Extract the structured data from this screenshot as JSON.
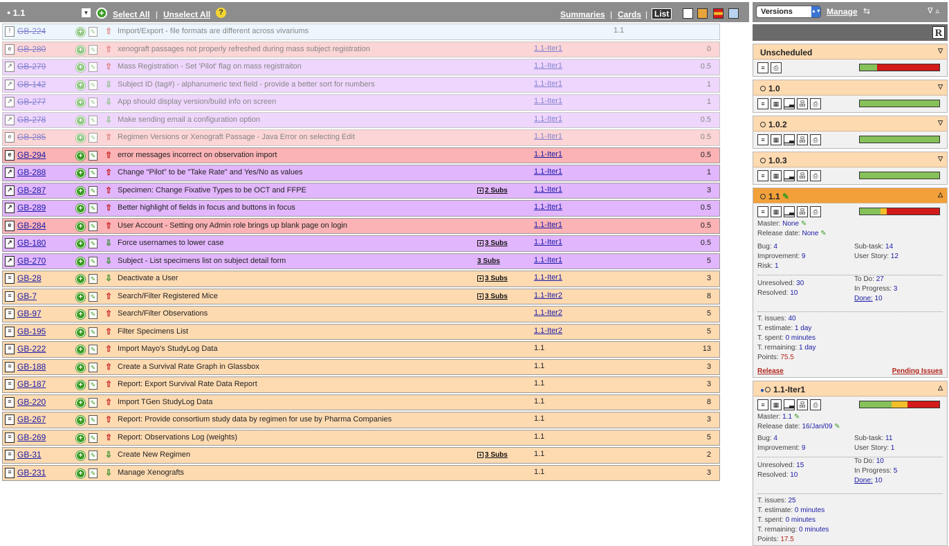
{
  "header": {
    "title": "1.1",
    "select_all": "Select All",
    "separator": "|",
    "unselect_all": "Unselect All",
    "views": [
      "Summaries",
      "Cards",
      "List"
    ],
    "active_view": "List"
  },
  "issues": [
    {
      "key": "GB-224",
      "type": "info",
      "type_glyph": "!",
      "priority": "up",
      "summary": "Import/Export - file formats are different across vivariums",
      "subs": "",
      "subs_plus": false,
      "version": "1.1",
      "version_link": false,
      "points": "",
      "done": true,
      "ver_offset": true
    },
    {
      "key": "GB-280",
      "type": "bug",
      "type_glyph": "e",
      "priority": "up",
      "summary": "xenograft passages not properly refreshed during mass subject registration",
      "subs": "",
      "subs_plus": false,
      "version": "1.1-Iter1",
      "version_link": true,
      "points": "0",
      "done": true
    },
    {
      "key": "GB-279",
      "type": "impr",
      "type_glyph": "↗",
      "priority": "up",
      "summary": "Mass Registration - Set 'Pilot' flag on mass registraiton",
      "subs": "",
      "subs_plus": false,
      "version": "1.1-Iter1",
      "version_link": true,
      "points": "0.5",
      "done": true
    },
    {
      "key": "GB-142",
      "type": "impr",
      "type_glyph": "↗",
      "priority": "down",
      "summary": "Subject ID (tag#) - alphanumeric text field - provide a better sort for numbers",
      "subs": "",
      "subs_plus": false,
      "version": "1.1-Iter1",
      "version_link": true,
      "points": "1",
      "done": true
    },
    {
      "key": "GB-277",
      "type": "impr",
      "type_glyph": "↗",
      "priority": "down",
      "summary": "App should display version/build info on screen",
      "subs": "",
      "subs_plus": false,
      "version": "1.1-Iter1",
      "version_link": true,
      "points": "1",
      "done": true
    },
    {
      "key": "GB-278",
      "type": "impr",
      "type_glyph": "↗",
      "priority": "down",
      "summary": "Make sending email a configuration option",
      "subs": "",
      "subs_plus": false,
      "version": "1.1-Iter1",
      "version_link": true,
      "points": "0.5",
      "done": true
    },
    {
      "key": "GB-285",
      "type": "bug",
      "type_glyph": "e",
      "priority": "up",
      "summary": "Regimen Versions or Xenograft Passage - Java Error on selecting Edit",
      "subs": "",
      "subs_plus": false,
      "version": "1.1-Iter1",
      "version_link": true,
      "points": "0.5",
      "done": true
    },
    {
      "key": "GB-294",
      "type": "bug",
      "type_glyph": "e",
      "priority": "up",
      "summary": "error messages incorrect on observation import",
      "subs": "",
      "subs_plus": false,
      "version": "1.1-Iter1",
      "version_link": true,
      "points": "0.5",
      "done": false
    },
    {
      "key": "GB-288",
      "type": "impr",
      "type_glyph": "↗",
      "priority": "up",
      "summary": "Change \"Pilot\" to be \"Take Rate\" and Yes/No as values",
      "subs": "",
      "subs_plus": false,
      "version": "1.1-Iter1",
      "version_link": true,
      "points": "1",
      "done": false
    },
    {
      "key": "GB-287",
      "type": "impr",
      "type_glyph": "↗",
      "priority": "up",
      "summary": "Specimen: Change Fixative Types to be OCT and FFPE",
      "subs": "2 Subs",
      "subs_plus": true,
      "version": "1.1-Iter1",
      "version_link": true,
      "points": "3",
      "done": false
    },
    {
      "key": "GB-289",
      "type": "impr",
      "type_glyph": "↗",
      "priority": "up",
      "summary": "Better highlight of fields in focus and buttons in focus",
      "subs": "",
      "subs_plus": false,
      "version": "1.1-Iter1",
      "version_link": true,
      "points": "0.5",
      "done": false
    },
    {
      "key": "GB-284",
      "type": "bug",
      "type_glyph": "e",
      "priority": "up",
      "summary": "User Account - Setting ony Admin role brings up blank page on login",
      "subs": "",
      "subs_plus": false,
      "version": "1.1-Iter1",
      "version_link": true,
      "points": "0.5",
      "done": false
    },
    {
      "key": "GB-180",
      "type": "impr",
      "type_glyph": "↗",
      "priority": "down",
      "summary": "Force usernames to lower case",
      "subs": "3 Subs",
      "subs_plus": true,
      "version": "1.1-Iter1",
      "version_link": true,
      "points": "0.5",
      "done": false
    },
    {
      "key": "GB-270",
      "type": "impr",
      "type_glyph": "↗",
      "priority": "down",
      "summary": "Subject - List specimens list on subject detail form",
      "subs": "3 Subs",
      "subs_plus": false,
      "version": "1.1-Iter1",
      "version_link": true,
      "points": "5",
      "done": false
    },
    {
      "key": "GB-28",
      "type": "story",
      "type_glyph": "≡",
      "priority": "down",
      "summary": "Deactivate a User",
      "subs": "3 Subs",
      "subs_plus": true,
      "version": "1.1-Iter1",
      "version_link": true,
      "points": "3",
      "done": false
    },
    {
      "key": "GB-7",
      "type": "story",
      "type_glyph": "≡",
      "priority": "up",
      "summary": "Search/Filter Registered Mice",
      "subs": "3 Subs",
      "subs_plus": true,
      "version": "1.1-Iter2",
      "version_link": true,
      "points": "8",
      "done": false
    },
    {
      "key": "GB-97",
      "type": "story",
      "type_glyph": "≡",
      "priority": "up",
      "summary": "Search/Filter Observations",
      "subs": "",
      "subs_plus": false,
      "version": "1.1-Iter2",
      "version_link": true,
      "points": "5",
      "done": false
    },
    {
      "key": "GB-195",
      "type": "story",
      "type_glyph": "≡",
      "priority": "up",
      "summary": "Filter Specimens List",
      "subs": "",
      "subs_plus": false,
      "version": "1.1-Iter2",
      "version_link": true,
      "points": "5",
      "done": false
    },
    {
      "key": "GB-222",
      "type": "story",
      "type_glyph": "≡",
      "priority": "up",
      "summary": "Import Mayo's StudyLog Data",
      "subs": "",
      "subs_plus": false,
      "version": "1.1",
      "version_link": false,
      "points": "13",
      "done": false
    },
    {
      "key": "GB-188",
      "type": "story",
      "type_glyph": "≡",
      "priority": "up",
      "summary": "Create a Survival Rate Graph in Glassbox",
      "subs": "",
      "subs_plus": false,
      "version": "1.1",
      "version_link": false,
      "points": "3",
      "done": false
    },
    {
      "key": "GB-187",
      "type": "story",
      "type_glyph": "≡",
      "priority": "up",
      "summary": "Report: Export Survival Rate Data Report",
      "subs": "",
      "subs_plus": false,
      "version": "1.1",
      "version_link": false,
      "points": "3",
      "done": false
    },
    {
      "key": "GB-220",
      "type": "story",
      "type_glyph": "≡",
      "priority": "up",
      "summary": "Import TGen StudyLog Data",
      "subs": "",
      "subs_plus": false,
      "version": "1.1",
      "version_link": false,
      "points": "8",
      "done": false
    },
    {
      "key": "GB-267",
      "type": "story",
      "type_glyph": "≡",
      "priority": "up",
      "summary": "Report: Provide consortium study data by regimen for use by Pharma Companies",
      "subs": "",
      "subs_plus": false,
      "version": "1.1",
      "version_link": false,
      "points": "3",
      "done": false
    },
    {
      "key": "GB-269",
      "type": "story",
      "type_glyph": "≡",
      "priority": "up",
      "summary": "Report: Observations Log (weights)",
      "subs": "",
      "subs_plus": false,
      "version": "1.1",
      "version_link": false,
      "points": "5",
      "done": false
    },
    {
      "key": "GB-31",
      "type": "story",
      "type_glyph": "≡",
      "priority": "down",
      "summary": "Create New Regimen",
      "subs": "3 Subs",
      "subs_plus": true,
      "version": "1.1",
      "version_link": false,
      "points": "2",
      "done": false
    },
    {
      "key": "GB-231",
      "type": "story",
      "type_glyph": "≡",
      "priority": "down",
      "summary": "Manage Xenografts",
      "subs": "",
      "subs_plus": false,
      "version": "1.1",
      "version_link": false,
      "points": "3",
      "done": false
    }
  ],
  "panel": {
    "versions_select": "Versions",
    "manage": "Manage",
    "r_button": "R",
    "unscheduled": {
      "name": "Unscheduled",
      "progress": {
        "green": 0.22,
        "yellow": 0,
        "red": 0.78
      }
    },
    "collapsed": [
      {
        "name": "1.0",
        "progress": {
          "green": 1,
          "yellow": 0,
          "red": 0
        }
      },
      {
        "name": "1.0.2",
        "progress": {
          "green": 1,
          "yellow": 0,
          "red": 0
        }
      },
      {
        "name": "1.0.3",
        "progress": {
          "green": 1,
          "yellow": 0,
          "red": 0
        }
      }
    ],
    "v11": {
      "name": "1.1",
      "progress": {
        "green": 0.26,
        "yellow": 0.08,
        "red": 0.66
      },
      "master_label": "Master:",
      "master": "None",
      "release_label": "Release date:",
      "release": "None",
      "bug_label": "Bug:",
      "bug": "4",
      "subtask_label": "Sub-task:",
      "subtask": "14",
      "impr_label": "Improvement:",
      "impr": "9",
      "story_label": "User Story:",
      "story": "12",
      "risk_label": "Risk:",
      "risk": "1",
      "unresolved_label": "Unresolved:",
      "unresolved": "30",
      "resolved_label": "Resolved:",
      "resolved": "10",
      "todo_label": "To Do:",
      "todo": "27",
      "inprog_label": "In Progress:",
      "inprog": "3",
      "done_label": "Done:",
      "done": "10",
      "tissues_label": "T. issues:",
      "tissues": "40",
      "testimate_label": "T. estimate:",
      "testimate": "1 day",
      "tspent_label": "T. spent:",
      "tspent": "0 minutes",
      "tremaining_label": "T. remaining:",
      "tremaining": "1 day",
      "points_label": "Points:",
      "points": "75.5",
      "release_link": "Release",
      "pending_link": "Pending Issues"
    },
    "iter1": {
      "name": "1.1-Iter1",
      "progress": {
        "green": 0.4,
        "yellow": 0.2,
        "red": 0.4
      },
      "master_label": "Master:",
      "master": "1.1",
      "release_label": "Release date:",
      "release": "16/Jan/09",
      "bug_label": "Bug:",
      "bug": "4",
      "subtask_label": "Sub-task:",
      "subtask": "11",
      "impr_label": "Improvement:",
      "impr": "9",
      "story_label": "User Story:",
      "story": "1",
      "unresolved_label": "Unresolved:",
      "unresolved": "15",
      "resolved_label": "Resolved:",
      "resolved": "10",
      "todo_label": "To Do:",
      "todo": "10",
      "inprog_label": "In Progress:",
      "inprog": "5",
      "done_label": "Done:",
      "done": "10",
      "tissues_label": "T. issues:",
      "tissues": "25",
      "testimate_label": "T. estimate:",
      "testimate": "0 minutes",
      "tspent_label": "T. spent:",
      "tspent": "0 minutes",
      "tremaining_label": "T. remaining:",
      "tremaining": "0 minutes",
      "points_label": "Points:",
      "points": "17.5"
    }
  }
}
